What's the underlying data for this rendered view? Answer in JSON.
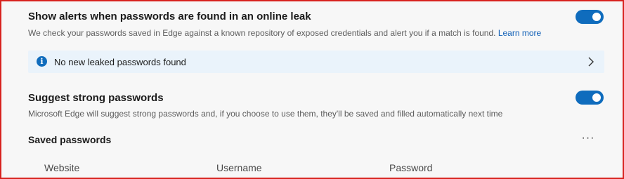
{
  "leak_alerts": {
    "title": "Show alerts when passwords are found in an online leak",
    "description": "We check your passwords saved in Edge against a known repository of exposed credentials and alert you if a match is found.",
    "learn_more": "Learn more",
    "enabled": true
  },
  "leak_status": {
    "icon": "info-icon",
    "icon_glyph": "i",
    "text": "No new leaked passwords found"
  },
  "suggest_passwords": {
    "title": "Suggest strong passwords",
    "description": "Microsoft Edge will suggest strong passwords and, if you choose to use them, they'll be saved and filled automatically next time",
    "enabled": true
  },
  "saved_passwords": {
    "title": "Saved passwords",
    "more_label": "···",
    "columns": [
      "Website",
      "Username",
      "Password"
    ]
  },
  "colors": {
    "accent": "#0f6cbd",
    "link": "#0f5fb6",
    "info_background": "#eaf3fb",
    "frame_border": "#d8231f"
  }
}
